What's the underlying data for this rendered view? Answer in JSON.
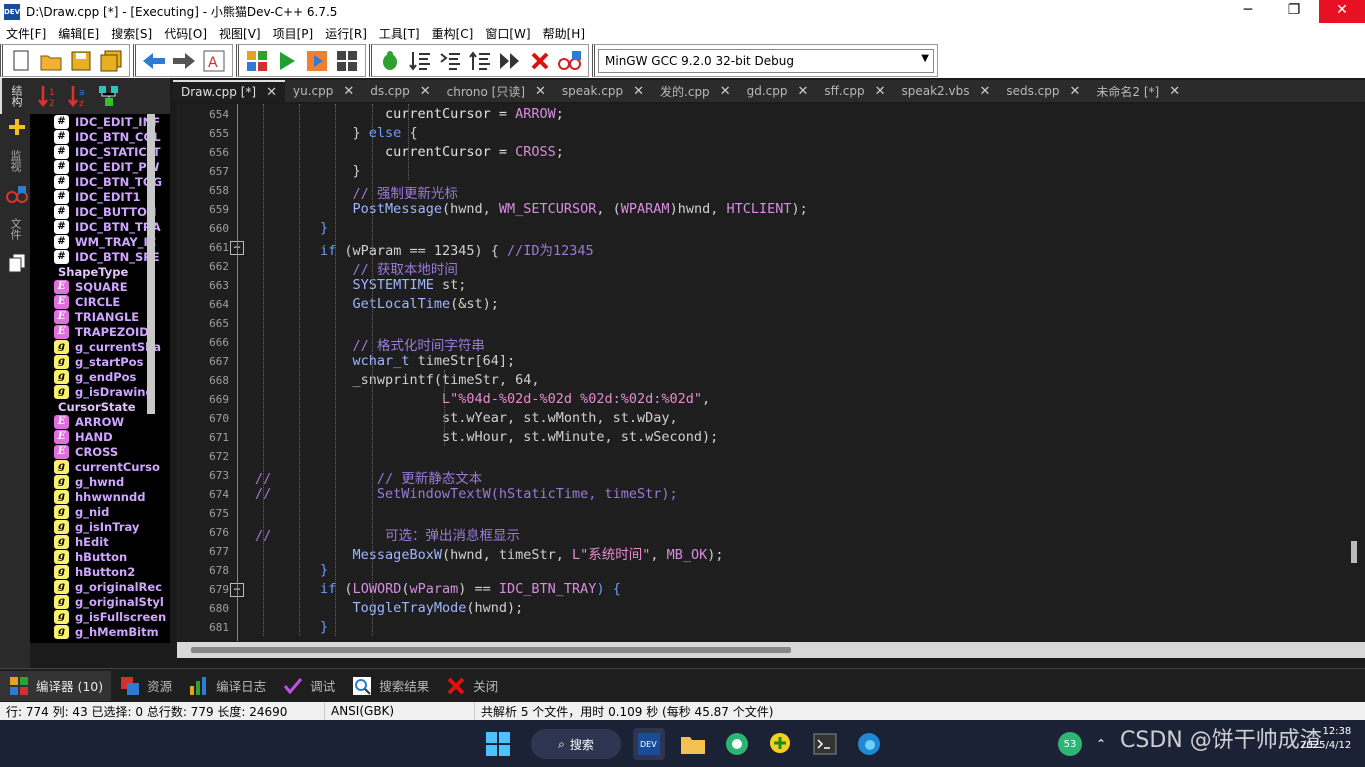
{
  "window": {
    "title": "D:\\Draw.cpp [*] - [Executing] - 小熊猫Dev-C++ 6.7.5",
    "app_icon_text": "DEV",
    "min_glyph": "─",
    "max_glyph": "❐",
    "close_glyph": "✕"
  },
  "menu": [
    "文件[F]",
    "编辑[E]",
    "搜索[S]",
    "代码[O]",
    "视图[V]",
    "项目[P]",
    "运行[R]",
    "工具[T]",
    "重构[C]",
    "窗口[W]",
    "帮助[H]"
  ],
  "toolbar": {
    "compiler": "MinGW GCC 9.2.0 32-bit Debug",
    "buttons": [
      "new-file",
      "open-folder",
      "save",
      "save-all",
      "back",
      "forward",
      "format",
      "compile",
      "run",
      "compile-run",
      "rebuild",
      "debug",
      "step-over",
      "step-into",
      "step-out",
      "continue",
      "stop",
      "add-watch"
    ]
  },
  "left_strip": {
    "tabs": [
      "结构",
      "监视",
      "文件"
    ]
  },
  "class_browser": {
    "items": [
      {
        "icon": "#",
        "kind": "macro",
        "label": "IDC_EDIT_INF"
      },
      {
        "icon": "#",
        "kind": "macro",
        "label": "IDC_BTN_COL"
      },
      {
        "icon": "#",
        "kind": "macro",
        "label": "IDC_STATIC_T"
      },
      {
        "icon": "#",
        "kind": "macro",
        "label": "IDC_EDIT_PW"
      },
      {
        "icon": "#",
        "kind": "macro",
        "label": "IDC_BTN_TOG"
      },
      {
        "icon": "#",
        "kind": "macro",
        "label": "IDC_EDIT1"
      },
      {
        "icon": "#",
        "kind": "macro",
        "label": "IDC_BUTTON"
      },
      {
        "icon": "#",
        "kind": "macro",
        "label": "IDC_BTN_TRA"
      },
      {
        "icon": "#",
        "kind": "macro",
        "label": "WM_TRAY_IC"
      },
      {
        "icon": "#",
        "kind": "macro",
        "label": "IDC_BTN_SPE"
      },
      {
        "icon": "",
        "kind": "group",
        "label": "ShapeType"
      },
      {
        "icon": "E",
        "kind": "enum",
        "label": "SQUARE"
      },
      {
        "icon": "E",
        "kind": "enum",
        "label": "CIRCLE"
      },
      {
        "icon": "E",
        "kind": "enum",
        "label": "TRIANGLE"
      },
      {
        "icon": "E",
        "kind": "enum",
        "label": "TRAPEZOID"
      },
      {
        "icon": "g",
        "kind": "global",
        "label": "g_currentSha"
      },
      {
        "icon": "g",
        "kind": "global",
        "label": "g_startPos"
      },
      {
        "icon": "g",
        "kind": "global",
        "label": "g_endPos"
      },
      {
        "icon": "g",
        "kind": "global",
        "label": "g_isDrawing"
      },
      {
        "icon": "",
        "kind": "group",
        "label": "CursorState"
      },
      {
        "icon": "E",
        "kind": "enum",
        "label": "ARROW"
      },
      {
        "icon": "E",
        "kind": "enum",
        "label": "HAND"
      },
      {
        "icon": "E",
        "kind": "enum",
        "label": "CROSS"
      },
      {
        "icon": "g",
        "kind": "global",
        "label": "currentCurso"
      },
      {
        "icon": "g",
        "kind": "global",
        "label": "g_hwnd"
      },
      {
        "icon": "g",
        "kind": "global",
        "label": "hhwwnndd"
      },
      {
        "icon": "g",
        "kind": "global",
        "label": "g_nid"
      },
      {
        "icon": "g",
        "kind": "global",
        "label": "g_isInTray"
      },
      {
        "icon": "g",
        "kind": "global",
        "label": "hEdit"
      },
      {
        "icon": "g",
        "kind": "global",
        "label": "hButton"
      },
      {
        "icon": "g",
        "kind": "global",
        "label": "hButton2"
      },
      {
        "icon": "g",
        "kind": "global",
        "label": "g_originalRec"
      },
      {
        "icon": "g",
        "kind": "global",
        "label": "g_originalStyl"
      },
      {
        "icon": "g",
        "kind": "global",
        "label": "g_isFullscreen"
      },
      {
        "icon": "g",
        "kind": "global",
        "label": "g_hMemBitm"
      }
    ]
  },
  "tabs": [
    {
      "label": "Draw.cpp [*]",
      "active": true
    },
    {
      "label": "yu.cpp",
      "active": false
    },
    {
      "label": "ds.cpp",
      "active": false
    },
    {
      "label": "chrono [只读]",
      "active": false
    },
    {
      "label": "speak.cpp",
      "active": false
    },
    {
      "label": "发的.cpp",
      "active": false
    },
    {
      "label": "gd.cpp",
      "active": false
    },
    {
      "label": "sff.cpp",
      "active": false
    },
    {
      "label": "speak2.vbs",
      "active": false
    },
    {
      "label": "seds.cpp",
      "active": false
    },
    {
      "label": "未命名2 [*]",
      "active": false
    }
  ],
  "tab_close_glyph": "✕",
  "fold_glyph": "−",
  "code": {
    "lines": [
      {
        "n": "654",
        "fold": false,
        "segs": [
          [
            "                ",
            ""
          ],
          [
            "currentCursor = ",
            "id"
          ],
          [
            "ARROW",
            "mc"
          ],
          [
            ";",
            "sy"
          ]
        ]
      },
      {
        "n": "655",
        "fold": false,
        "segs": [
          [
            "            } ",
            "sy"
          ],
          [
            "else",
            "kw"
          ],
          [
            " {",
            "sy"
          ]
        ]
      },
      {
        "n": "656",
        "fold": false,
        "segs": [
          [
            "                ",
            ""
          ],
          [
            "currentCursor = ",
            "id"
          ],
          [
            "CROSS",
            "mc"
          ],
          [
            ";",
            "sy"
          ]
        ]
      },
      {
        "n": "657",
        "fold": false,
        "segs": [
          [
            "            }",
            "sy"
          ]
        ]
      },
      {
        "n": "658",
        "fold": false,
        "segs": [
          [
            "            ",
            ""
          ],
          [
            "// 强制更新光标",
            "cm"
          ]
        ]
      },
      {
        "n": "659",
        "fold": false,
        "segs": [
          [
            "            ",
            ""
          ],
          [
            "PostMessage",
            "ty"
          ],
          [
            "(hwnd, ",
            "sy"
          ],
          [
            "WM_SETCURSOR",
            "mc"
          ],
          [
            ", (",
            "sy"
          ],
          [
            "WPARAM",
            "mc"
          ],
          [
            ")hwnd, ",
            "sy"
          ],
          [
            "HTCLIENT",
            "mc"
          ],
          [
            ");",
            "sy"
          ]
        ]
      },
      {
        "n": "660",
        "fold": false,
        "segs": [
          [
            "        }",
            "kw"
          ]
        ]
      },
      {
        "n": "661",
        "fold": true,
        "segs": [
          [
            "        ",
            ""
          ],
          [
            "if",
            "kw"
          ],
          [
            " (wParam == 12345) { ",
            "sy"
          ],
          [
            "//ID为12345",
            "cm"
          ]
        ]
      },
      {
        "n": "662",
        "fold": false,
        "segs": [
          [
            "            ",
            ""
          ],
          [
            "// 获取本地时间",
            "cm"
          ]
        ]
      },
      {
        "n": "663",
        "fold": false,
        "segs": [
          [
            "            ",
            ""
          ],
          [
            "SYSTEMTIME",
            "ty"
          ],
          [
            " st;",
            "sy"
          ]
        ]
      },
      {
        "n": "664",
        "fold": false,
        "segs": [
          [
            "            ",
            ""
          ],
          [
            "GetLocalTime",
            "ty"
          ],
          [
            "(&st);",
            "sy"
          ]
        ]
      },
      {
        "n": "665",
        "fold": false,
        "segs": [
          [
            "",
            ""
          ]
        ]
      },
      {
        "n": "666",
        "fold": false,
        "segs": [
          [
            "            ",
            ""
          ],
          [
            "// 格式化时间字符串",
            "cm"
          ]
        ]
      },
      {
        "n": "667",
        "fold": false,
        "segs": [
          [
            "            ",
            ""
          ],
          [
            "wchar_t",
            "ty"
          ],
          [
            " timeStr[64];",
            "sy"
          ]
        ]
      },
      {
        "n": "668",
        "fold": false,
        "segs": [
          [
            "            ",
            ""
          ],
          [
            "_snwprintf(timeStr, 64,",
            "sy"
          ]
        ]
      },
      {
        "n": "669",
        "fold": false,
        "segs": [
          [
            "                       ",
            ""
          ],
          [
            "L\"%04d-%02d-%02d %02d:%02d:%02d\"",
            "st"
          ],
          [
            ",",
            "sy"
          ]
        ]
      },
      {
        "n": "670",
        "fold": false,
        "segs": [
          [
            "                       ",
            ""
          ],
          [
            "st.wYear, st.wMonth, st.wDay,",
            "sy"
          ]
        ]
      },
      {
        "n": "671",
        "fold": false,
        "segs": [
          [
            "                       ",
            ""
          ],
          [
            "st.wHour, st.wMinute, st.wSecond);",
            "sy"
          ]
        ]
      },
      {
        "n": "672",
        "fold": false,
        "segs": [
          [
            "",
            ""
          ]
        ]
      },
      {
        "n": "673",
        "fold": false,
        "segs": [
          [
            "//             // 更新静态文本",
            "cm"
          ]
        ]
      },
      {
        "n": "674",
        "fold": false,
        "segs": [
          [
            "//             SetWindowTextW(hStaticTime, timeStr);",
            "cm"
          ]
        ]
      },
      {
        "n": "675",
        "fold": false,
        "segs": [
          [
            "",
            ""
          ]
        ]
      },
      {
        "n": "676",
        "fold": false,
        "segs": [
          [
            "//              可选：弹出消息框显示",
            "cm"
          ]
        ]
      },
      {
        "n": "677",
        "fold": false,
        "segs": [
          [
            "            ",
            ""
          ],
          [
            "MessageBoxW",
            "ty"
          ],
          [
            "(hwnd, timeStr, ",
            "sy"
          ],
          [
            "L\"系统时间\"",
            "st"
          ],
          [
            ", ",
            "sy"
          ],
          [
            "MB_OK",
            "mc"
          ],
          [
            ");",
            "sy"
          ]
        ]
      },
      {
        "n": "678",
        "fold": false,
        "segs": [
          [
            "        }",
            "kw"
          ]
        ]
      },
      {
        "n": "679",
        "fold": true,
        "segs": [
          [
            "        ",
            ""
          ],
          [
            "if",
            "kw"
          ],
          [
            " (",
            "sy"
          ],
          [
            "LOWORD",
            "mc"
          ],
          [
            "(",
            "sy"
          ],
          [
            "wParam",
            "mc"
          ],
          [
            ") == ",
            "sy"
          ],
          [
            "IDC_BTN_TRAY",
            "mc"
          ],
          [
            ") {",
            "kw"
          ]
        ]
      },
      {
        "n": "680",
        "fold": false,
        "segs": [
          [
            "            ",
            ""
          ],
          [
            "ToggleTrayMode",
            "ty"
          ],
          [
            "(hwnd);",
            "sy"
          ]
        ]
      },
      {
        "n": "681",
        "fold": false,
        "segs": [
          [
            "        }",
            "kw"
          ]
        ]
      }
    ]
  },
  "bottom_tabs": [
    {
      "label": "编译器 (10)",
      "icon": "compiler-icon",
      "active": true
    },
    {
      "label": "资源",
      "icon": "resource-icon",
      "active": false
    },
    {
      "label": "编译日志",
      "icon": "chart-icon",
      "active": false
    },
    {
      "label": "调试",
      "icon": "check-icon",
      "active": false
    },
    {
      "label": "搜索结果",
      "icon": "search-icon",
      "active": false
    },
    {
      "label": "关闭",
      "icon": "close-icon",
      "active": false
    }
  ],
  "status": {
    "position": "行:  774   列:    43  已选择:    0  总行数:  779  长度: 24690",
    "encoding": "ANSI(GBK)",
    "message": "共解析 5 个文件，用时 0.109 秒 (每秒 45.87 个文件)"
  },
  "taskbar": {
    "search_label": "搜索",
    "badge": "53",
    "watermark": "CSDN @饼干帅成渣",
    "time": "12:38",
    "date": "2025/4/12"
  },
  "colors": {
    "editor_bg": "#1e1e1e",
    "keyword": "#6f9bff",
    "comment": "#9a7ad8",
    "string": "#e88ad0",
    "close_button": "#e81123"
  }
}
